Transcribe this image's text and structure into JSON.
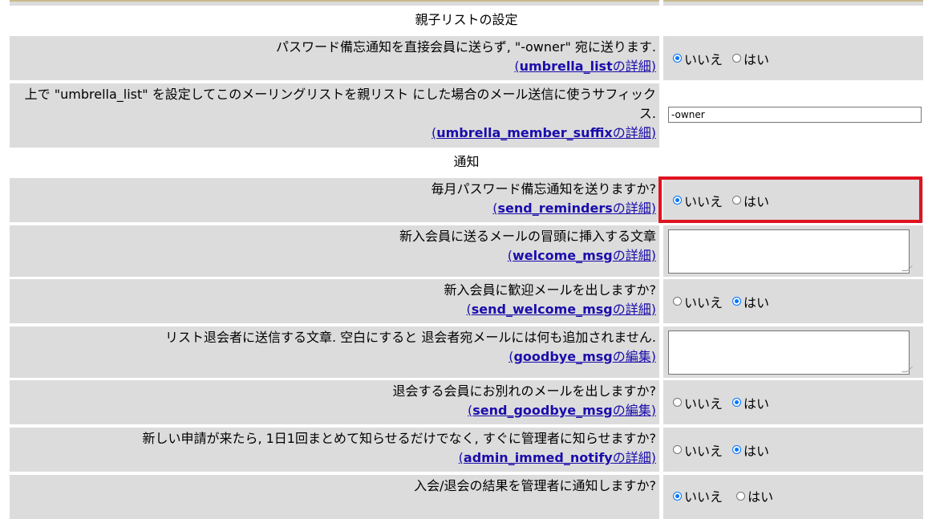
{
  "sections": {
    "umbrella": "親子リストの設定",
    "notify": "通知"
  },
  "options": {
    "no": "いいえ",
    "yes": "はい"
  },
  "rows": [
    {
      "label": "パスワード備忘通知を直接会員に送らず, \"-owner\" 宛に送ります.",
      "link_key": "umbrella_list",
      "link_suffix": "の詳細",
      "type": "radio",
      "selected": "no"
    },
    {
      "label": "上で \"umbrella_list\" を設定してこのメーリングリストを親リスト にした場合のメール送信に使うサフィックス.",
      "link_key": "umbrella_member_suffix",
      "link_suffix": "の詳細",
      "type": "text",
      "value": "-owner"
    },
    {
      "label": "毎月パスワード備忘通知を送りますか?",
      "link_key": "send_reminders",
      "link_suffix": "の詳細",
      "type": "radio",
      "selected": "no"
    },
    {
      "label": "新入会員に送るメールの冒頭に挿入する文章",
      "link_key": "welcome_msg",
      "link_suffix": "の詳細",
      "type": "textarea",
      "value": ""
    },
    {
      "label": "新入会員に歓迎メールを出しますか?",
      "link_key": "send_welcome_msg",
      "link_suffix": "の詳細",
      "type": "radio",
      "selected": "yes"
    },
    {
      "label": "リスト退会者に送信する文章. 空白にすると 退会者宛メールには何も追加されません.",
      "link_key": "goodbye_msg",
      "link_suffix": "の編集",
      "type": "textarea",
      "value": ""
    },
    {
      "label": "退会する会員にお別れのメールを出しますか?",
      "link_key": "send_goodbye_msg",
      "link_suffix": "の編集",
      "type": "radio",
      "selected": "yes"
    },
    {
      "label": "新しい申請が来たら, 1日1回まとめて知らせるだけでなく, すぐに管理者に知らせますか?",
      "link_key": "admin_immed_notify",
      "link_suffix": "の詳細",
      "type": "radio",
      "selected": "yes"
    },
    {
      "label": "入会/退会の結果を管理者に通知しますか?",
      "type": "radio",
      "selected": "no"
    }
  ],
  "highlight_color": "#e0131f",
  "link_color": "#1a0dab"
}
